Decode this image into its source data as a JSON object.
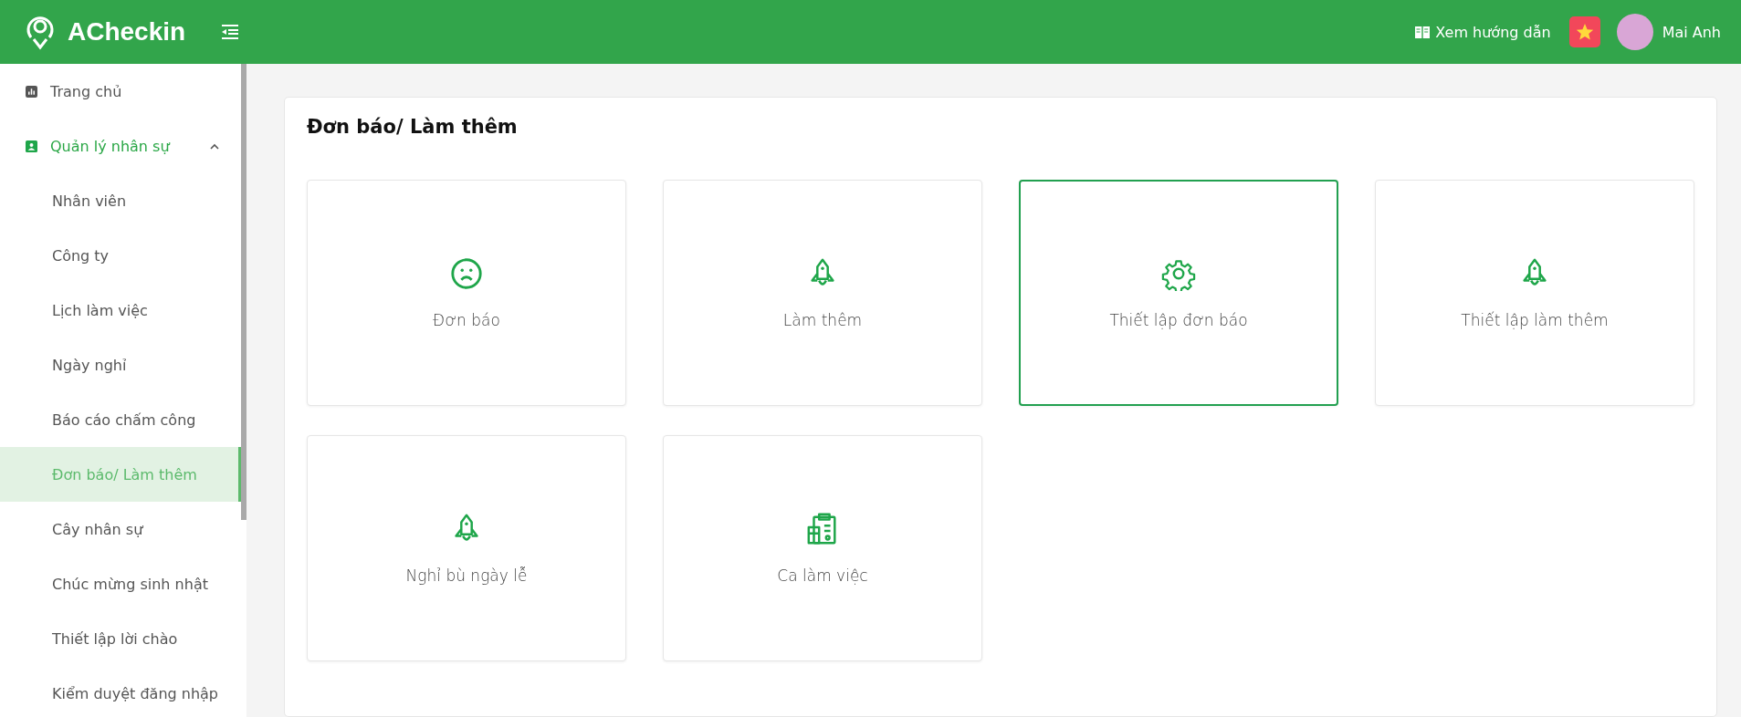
{
  "header": {
    "brand": "ACheckin",
    "guide": "Xem hướng dẫn",
    "user": "Mai Anh"
  },
  "sidebar": {
    "items": [
      {
        "label": "Trang chủ",
        "kind": "chart",
        "selected": false
      },
      {
        "label": "Quản lý nhân sự",
        "kind": "person",
        "selected": false,
        "expanded": true,
        "children": [
          {
            "label": "Nhân viên",
            "selected": false
          },
          {
            "label": "Công ty",
            "selected": false
          },
          {
            "label": "Lịch làm việc",
            "selected": false
          },
          {
            "label": "Ngày nghỉ",
            "selected": false
          },
          {
            "label": "Báo cáo chấm công",
            "selected": false
          },
          {
            "label": "Đơn báo/ Làm thêm",
            "selected": true
          },
          {
            "label": "Cây nhân sự",
            "selected": false
          },
          {
            "label": "Chúc mừng sinh nhật",
            "selected": false
          },
          {
            "label": "Thiết lập lời chào",
            "selected": false
          },
          {
            "label": "Kiểm duyệt đăng nhập",
            "selected": false
          }
        ]
      }
    ]
  },
  "panel": {
    "title": "Đơn báo/ Làm thêm",
    "tiles": [
      {
        "label": "Đơn báo",
        "kind": "sad",
        "selected": false
      },
      {
        "label": "Làm thêm",
        "kind": "rocket",
        "selected": false
      },
      {
        "label": "Thiết lập đơn báo",
        "kind": "gear",
        "selected": true
      },
      {
        "label": "Thiết lập làm thêm",
        "kind": "rocket",
        "selected": false
      },
      {
        "label": "Nghỉ bù ngày lễ",
        "kind": "rocket",
        "selected": false
      },
      {
        "label": "Ca làm việc",
        "kind": "clipboard",
        "selected": false
      }
    ]
  }
}
